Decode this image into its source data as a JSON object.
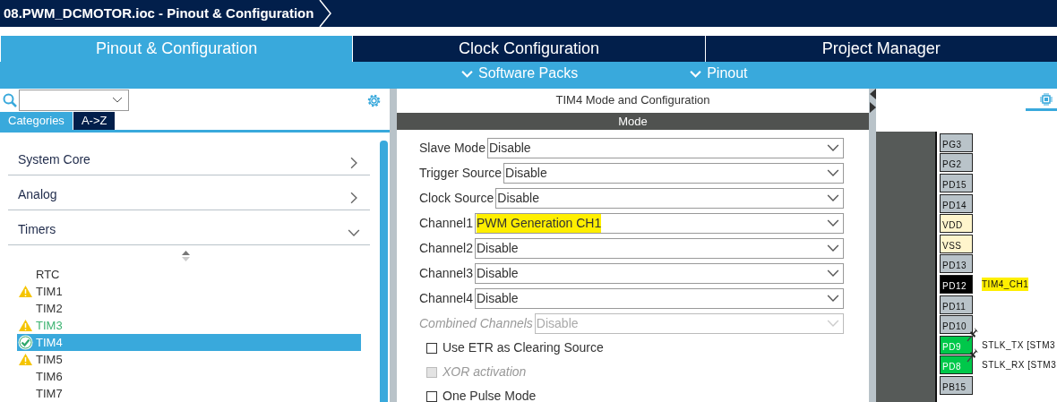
{
  "title_bar": {
    "breadcrumb": "08.PWM_DCMOTOR.ioc - Pinout & Configuration"
  },
  "tabs": [
    {
      "label": "Pinout & Configuration",
      "selected": true
    },
    {
      "label": "Clock Configuration",
      "selected": false
    },
    {
      "label": "Project Manager",
      "selected": false
    }
  ],
  "submenus": [
    {
      "label": "Software Packs"
    },
    {
      "label": "Pinout"
    }
  ],
  "left_panel": {
    "view_tabs": [
      {
        "label": "Categories",
        "selected": true
      },
      {
        "label": "A->Z",
        "selected": false
      }
    ],
    "categories": [
      {
        "label": "System Core",
        "expanded": false
      },
      {
        "label": "Analog",
        "expanded": false
      },
      {
        "label": "Timers",
        "expanded": true,
        "children": [
          {
            "label": "RTC",
            "kind": "plain",
            "configured": false,
            "selected": false
          },
          {
            "label": "TIM1",
            "kind": "warning",
            "configured": false,
            "selected": false
          },
          {
            "label": "TIM2",
            "kind": "plain",
            "configured": false,
            "selected": false
          },
          {
            "label": "TIM3",
            "kind": "warning",
            "configured": true,
            "selected": false
          },
          {
            "label": "TIM4",
            "kind": "ok",
            "configured": false,
            "selected": true
          },
          {
            "label": "TIM5",
            "kind": "warning",
            "configured": false,
            "selected": false
          },
          {
            "label": "TIM6",
            "kind": "plain",
            "configured": false,
            "selected": false
          },
          {
            "label": "TIM7",
            "kind": "plain",
            "configured": false,
            "selected": false
          }
        ]
      }
    ]
  },
  "config_panel": {
    "title": "TIM4 Mode and Configuration",
    "section": "Mode",
    "fields": [
      {
        "label": "Slave Mode",
        "value": "Disable",
        "disabled": false,
        "highlighted": false
      },
      {
        "label": "Trigger Source",
        "value": "Disable",
        "disabled": false,
        "highlighted": false
      },
      {
        "label": "Clock Source",
        "value": "Disable",
        "disabled": false,
        "highlighted": false
      },
      {
        "label": "Channel1",
        "value": "PWM Generation CH1",
        "disabled": false,
        "highlighted": true
      },
      {
        "label": "Channel2",
        "value": "Disable",
        "disabled": false,
        "highlighted": false
      },
      {
        "label": "Channel3",
        "value": "Disable",
        "disabled": false,
        "highlighted": false
      },
      {
        "label": "Channel4",
        "value": "Disable",
        "disabled": false,
        "highlighted": false
      },
      {
        "label": "Combined Channels",
        "value": "Disable",
        "disabled": true,
        "highlighted": false
      }
    ],
    "checkboxes": [
      {
        "label": "Use ETR as Clearing Source",
        "checked": false,
        "disabled": false
      },
      {
        "label": "XOR activation",
        "checked": false,
        "disabled": true
      },
      {
        "label": "One Pulse Mode",
        "checked": false,
        "disabled": false
      }
    ]
  },
  "pinout": {
    "pins": [
      {
        "name": "PG3",
        "kind": "io",
        "pinned": false
      },
      {
        "name": "PG2",
        "kind": "io",
        "pinned": false
      },
      {
        "name": "PD15",
        "kind": "io",
        "pinned": false
      },
      {
        "name": "PD14",
        "kind": "io",
        "pinned": false
      },
      {
        "name": "VDD",
        "kind": "power",
        "pinned": false
      },
      {
        "name": "VSS",
        "kind": "power",
        "pinned": false
      },
      {
        "name": "PD13",
        "kind": "io",
        "pinned": false
      },
      {
        "name": "PD12",
        "kind": "selected",
        "pinned": false,
        "signal": "TIM4_CH1",
        "highlighted": true
      },
      {
        "name": "PD11",
        "kind": "io",
        "pinned": false
      },
      {
        "name": "PD10",
        "kind": "io",
        "pinned": false
      },
      {
        "name": "PD9",
        "kind": "assigned",
        "pinned": true,
        "signal": "STLK_TX [STM3",
        "highlighted": false
      },
      {
        "name": "PD8",
        "kind": "assigned",
        "pinned": true,
        "signal": "STLK_RX [STM3",
        "highlighted": false
      },
      {
        "name": "PB15",
        "kind": "io",
        "pinned": false
      }
    ]
  }
}
